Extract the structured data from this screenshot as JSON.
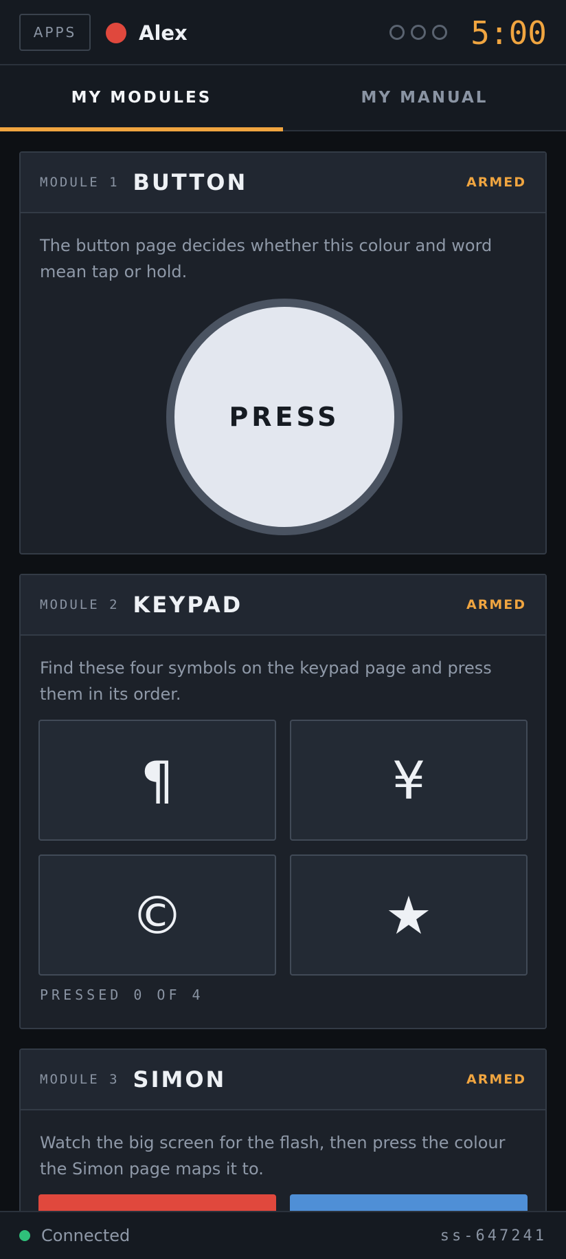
{
  "header": {
    "apps_label": "APPS",
    "player_name": "Alex",
    "player_color": "#e0483d",
    "strikes_total": 3,
    "strikes_used": 0,
    "timer": "5:00"
  },
  "tabs": [
    {
      "label": "MY MODULES",
      "active": true
    },
    {
      "label": "MY MANUAL",
      "active": false
    }
  ],
  "modules": [
    {
      "number": "MODULE 1",
      "title": "BUTTON",
      "status": "ARMED",
      "description": "The button page decides whether this colour and word mean tap or hold.",
      "button_label": "PRESS",
      "button_color": "#e3e7ef"
    },
    {
      "number": "MODULE 2",
      "title": "KEYPAD",
      "status": "ARMED",
      "description": "Find these four symbols on the keypad page and press them in its order.",
      "symbols": [
        "¶",
        "¥",
        "©",
        "★"
      ],
      "pressed_text": "PRESSED 0 OF 4"
    },
    {
      "number": "MODULE 3",
      "title": "SIMON",
      "status": "ARMED",
      "description": "Watch the big screen for the flash, then press the colour the Simon page maps it to.",
      "pad_colors": [
        "#e0483d",
        "#4f8fd6"
      ]
    }
  ],
  "footer": {
    "status_text": "Connected",
    "status_color": "#2fc07a",
    "session_id": "ss-647241"
  }
}
